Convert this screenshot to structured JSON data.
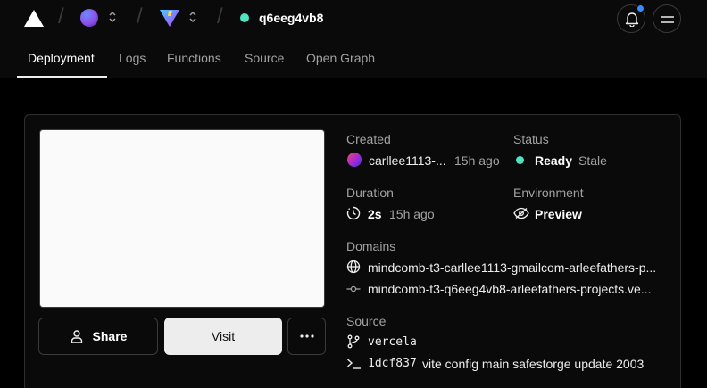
{
  "header": {
    "project_name": "q6eeg4vb8",
    "tabs": [
      "Deployment",
      "Logs",
      "Functions",
      "Source",
      "Open Graph"
    ]
  },
  "deployment": {
    "created_label": "Created",
    "creator": "carllee1113-...",
    "created_time": "15h ago",
    "status_label": "Status",
    "status_value": "Ready",
    "status_stale": "Stale",
    "duration_label": "Duration",
    "duration_value": "2s",
    "duration_time": "15h ago",
    "environment_label": "Environment",
    "environment_value": "Preview",
    "domains_label": "Domains",
    "domains": [
      "mindcomb-t3-carllee1113-gmailcom-arleefathers-p...",
      "mindcomb-t3-q6eeg4vb8-arleefathers-projects.ve..."
    ],
    "source_label": "Source",
    "branch": "vercela",
    "commit_hash": "1dcf837",
    "commit_message": "vite config main safestorge update 2003"
  },
  "actions": {
    "share_label": "Share",
    "visit_label": "Visit"
  },
  "colors": {
    "ready": "#50e3c2",
    "notification": "#3b8df5",
    "background": "#000000"
  },
  "icons": {
    "logo": "vercel-triangle-icon",
    "team_avatar": "team-avatar-icon",
    "project_logo": "vite-logo-icon",
    "notifications": "bell-icon",
    "menu": "menu-icon",
    "duration": "clock-icon",
    "environment": "eye-icon",
    "domain_primary": "globe-icon",
    "domain_secondary": "git-commit-icon",
    "branch": "git-branch-icon",
    "commit": "terminal-icon",
    "share": "user-icon",
    "more": "more-horizontal-icon"
  }
}
